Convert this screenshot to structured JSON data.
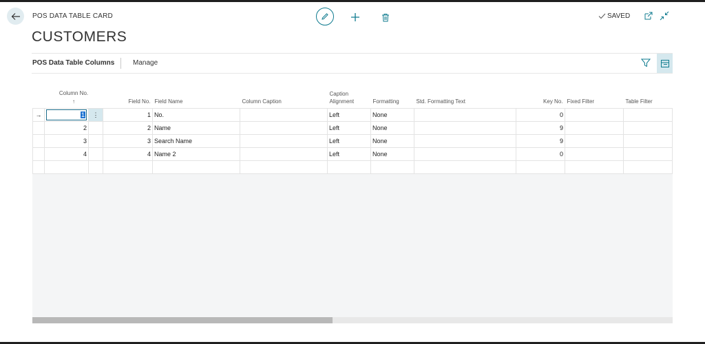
{
  "header": {
    "card_title": "POS DATA TABLE CARD",
    "page_title": "CUSTOMERS",
    "saved_label": "SAVED",
    "icons": {
      "back": "back-arrow-icon",
      "edit": "pencil-icon",
      "new": "plus-icon",
      "delete": "trash-icon",
      "saved": "check-icon",
      "popout": "open-new-window-icon",
      "collapse": "collapse-icon"
    }
  },
  "subpage": {
    "title": "POS Data Table Columns",
    "manage_label": "Manage",
    "icons": {
      "filter": "filter-icon",
      "factbox": "factbox-toggle-icon"
    }
  },
  "table": {
    "columns": {
      "column_no": "Column No.",
      "sort_indicator": "↑",
      "field_no": "Field No.",
      "field_name": "Field Name",
      "column_caption": "Column Caption",
      "caption_alignment_1": "Caption",
      "caption_alignment_2": "Alignment",
      "formatting": "Formatting",
      "std_formatting_text": "Std. Formatting Text",
      "key_no": "Key No.",
      "fixed_filter": "Fixed Filter",
      "table_filter": "Table Filter"
    },
    "rows": [
      {
        "column_no": "1",
        "field_no": "1",
        "field_name": "No.",
        "column_caption": "",
        "caption_alignment": "Left",
        "formatting": "None",
        "std_formatting_text": "",
        "key_no": "0",
        "fixed_filter": "",
        "table_filter": ""
      },
      {
        "column_no": "2",
        "field_no": "2",
        "field_name": "Name",
        "column_caption": "",
        "caption_alignment": "Left",
        "formatting": "None",
        "std_formatting_text": "",
        "key_no": "9",
        "fixed_filter": "",
        "table_filter": ""
      },
      {
        "column_no": "3",
        "field_no": "3",
        "field_name": "Search Name",
        "column_caption": "",
        "caption_alignment": "Left",
        "formatting": "None",
        "std_formatting_text": "",
        "key_no": "9",
        "fixed_filter": "",
        "table_filter": ""
      },
      {
        "column_no": "4",
        "field_no": "4",
        "field_name": "Name 2",
        "column_caption": "",
        "caption_alignment": "Left",
        "formatting": "None",
        "std_formatting_text": "",
        "key_no": "0",
        "fixed_filter": "",
        "table_filter": ""
      }
    ],
    "row_indicator": "→",
    "row_menu": "⋮"
  },
  "colors": {
    "accent": "#0f7b8f",
    "selection": "#d5e8ee",
    "grid_bg": "#f4f5f6"
  }
}
